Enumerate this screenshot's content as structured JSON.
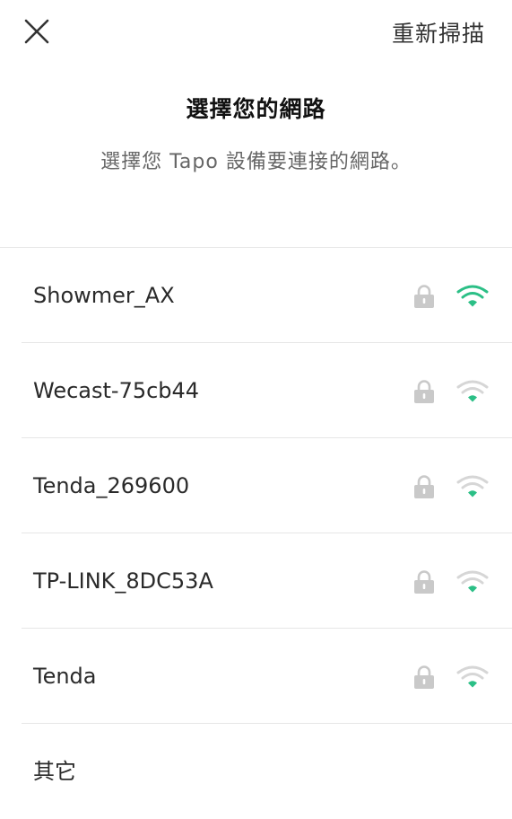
{
  "topbar": {
    "close_icon": "close-icon",
    "rescan_label": "重新掃描"
  },
  "header": {
    "title": "選擇您的網路",
    "subtitle": "選擇您 Tapo 設備要連接的網路。"
  },
  "networks": [
    {
      "ssid": "Showmer_AX",
      "secured": true,
      "signal_bars": 3
    },
    {
      "ssid": "Wecast-75cb44",
      "secured": true,
      "signal_bars": 1
    },
    {
      "ssid": "Tenda_269600",
      "secured": true,
      "signal_bars": 1
    },
    {
      "ssid": "TP-LINK_8DC53A",
      "secured": true,
      "signal_bars": 1
    },
    {
      "ssid": "Tenda",
      "secured": true,
      "signal_bars": 1
    }
  ],
  "other": {
    "label": "其它"
  },
  "colors": {
    "wifi_active": "#2bbf86",
    "wifi_inactive": "#d6d6d6",
    "lock": "#c9c9c9",
    "divider": "#e6e6e6"
  }
}
